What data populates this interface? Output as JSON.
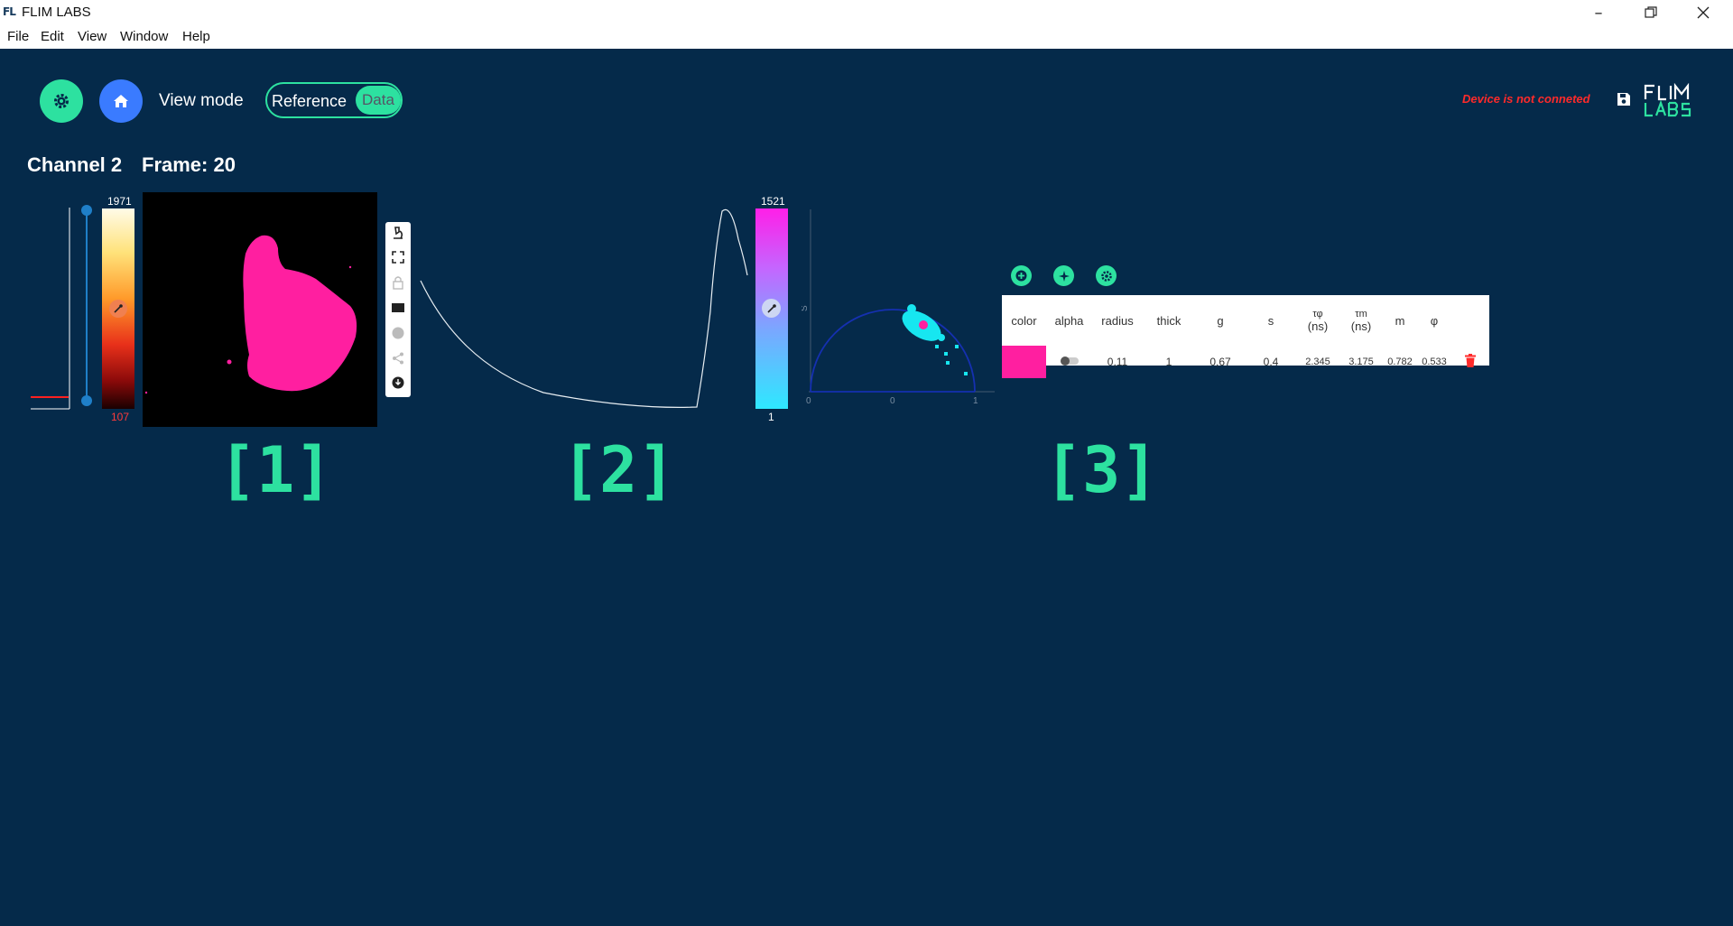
{
  "window": {
    "title": "FLIM LABS",
    "icon": "app-logo-icon",
    "controls": [
      "minimize",
      "restore",
      "close"
    ]
  },
  "menu": [
    "File",
    "Edit",
    "View",
    "Window",
    "Help"
  ],
  "toolbar": {
    "settings_icon": "gear-icon",
    "home_icon": "home-icon",
    "view_mode_label": "View mode",
    "toggle_options": [
      "Reference",
      "Data"
    ],
    "toggle_selected": "Data",
    "device_status": "Device is not conneted",
    "save_icon": "save-icon",
    "logo_text": "FLIM LABS"
  },
  "status": {
    "channel": "Channel 2",
    "frame": "Frame: 20"
  },
  "intensity": {
    "max": "1971",
    "min": "107",
    "slider_low": 0.0,
    "slider_high": 1.0,
    "picker_icon": "eyedropper-icon"
  },
  "image_tools": [
    "microscope-icon",
    "fullscreen-icon",
    "lock-icon",
    "rectangle-icon",
    "circle-icon",
    "share-icon",
    "download-icon"
  ],
  "decay": {
    "colorbar_max": "1521",
    "colorbar_min": "1",
    "picker_icon": "eyedropper-icon"
  },
  "phasor": {
    "y_axis_label": "S",
    "x_ticks": [
      "0",
      "0",
      "1"
    ]
  },
  "panel_labels": [
    "[1]",
    "[2]",
    "[3]"
  ],
  "roi_actions": [
    "add-circle-icon",
    "sparkle-icon",
    "settings-icon"
  ],
  "roi_table": {
    "columns": [
      {
        "label": "color",
        "unit": ""
      },
      {
        "label": "alpha",
        "unit": ""
      },
      {
        "label": "radius",
        "unit": ""
      },
      {
        "label": "thick",
        "unit": ""
      },
      {
        "label": "g",
        "unit": ""
      },
      {
        "label": "s",
        "unit": ""
      },
      {
        "label": "τφ",
        "unit": "(ns)"
      },
      {
        "label": "τm",
        "unit": "(ns)"
      },
      {
        "label": "m",
        "unit": ""
      },
      {
        "label": "φ",
        "unit": ""
      },
      {
        "label": "",
        "unit": ""
      }
    ],
    "rows": [
      {
        "color": "#ff1fa0",
        "alpha_icon": "toggle-icon",
        "radius": "0,11",
        "thick": "1",
        "g": "0,67",
        "s": "0,4",
        "tau_phi": "2.345",
        "tau_m": "3.175",
        "m": "0.782",
        "phi": "0.533",
        "delete_icon": "trash-icon"
      }
    ]
  },
  "colors": {
    "background": "#052a4a",
    "accent_green": "#2de1a0",
    "accent_blue": "#3a7bff",
    "roi_pink": "#ff1fa0",
    "phasor_cyan": "#17e6f0",
    "error_red": "#ff2a2a"
  }
}
